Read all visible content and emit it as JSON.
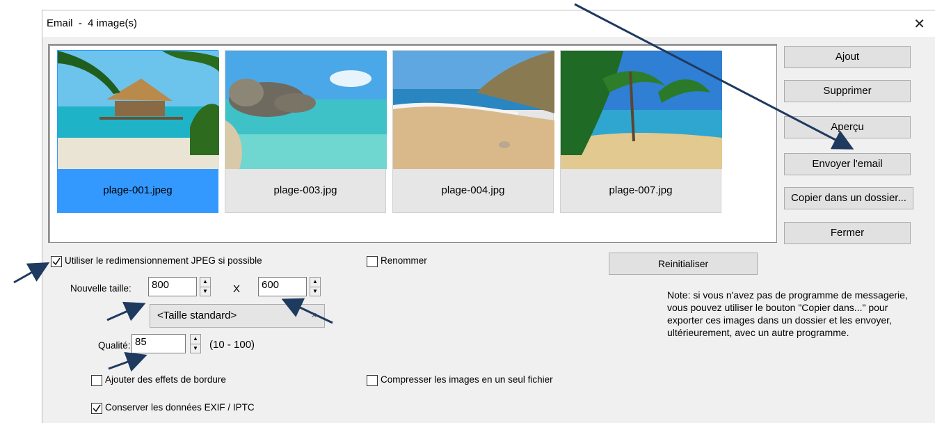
{
  "window": {
    "title": "Email  -  4 image(s)",
    "close_glyph": "✕"
  },
  "gallery": {
    "images": [
      {
        "filename": "plage-001.jpeg",
        "selected": true
      },
      {
        "filename": "plage-003.jpg",
        "selected": false
      },
      {
        "filename": "plage-004.jpg",
        "selected": false
      },
      {
        "filename": "plage-007.jpg",
        "selected": false
      }
    ]
  },
  "side_buttons": {
    "add": "Ajout",
    "remove": "Supprimer",
    "preview": "Aperçu",
    "send": "Envoyer l'email",
    "copy": "Copier dans un dossier...",
    "close": "Fermer"
  },
  "options": {
    "resize_jpeg": {
      "label": "Utiliser le redimensionnement JPEG si possible",
      "checked": true
    },
    "rename": {
      "label": "Renommer",
      "checked": false
    },
    "reset_button": "Reinitialiser",
    "new_size_label": "Nouvelle taille:",
    "width_value": "800",
    "x_separator": "X",
    "height_value": "600",
    "standard_size": "<Taille standard>",
    "quality_label": "Qualité:",
    "quality_value": "85",
    "quality_range": "(10 - 100)",
    "border_effects": {
      "label": "Ajouter des effets de bordure",
      "checked": false
    },
    "compress_single": {
      "label": "Compresser les images en un seul fichier",
      "checked": false
    },
    "keep_exif": {
      "label": "Conserver les données EXIF / IPTC",
      "checked": true
    }
  },
  "note": "Note: si vous n'avez pas de programme de messagerie, vous pouvez utiliser le bouton \"Copier dans...\" pour exporter ces images dans un dossier et les envoyer, ultérieurement, avec un autre programme.",
  "colors": {
    "selection": "#3399ff",
    "annotation_arrow": "#1f3a5f"
  },
  "icons": {
    "checkmark": "checkmark-icon",
    "spin_up": "spin-up-icon",
    "spin_down": "spin-down-icon",
    "dropdown": "chevron-down-icon"
  }
}
